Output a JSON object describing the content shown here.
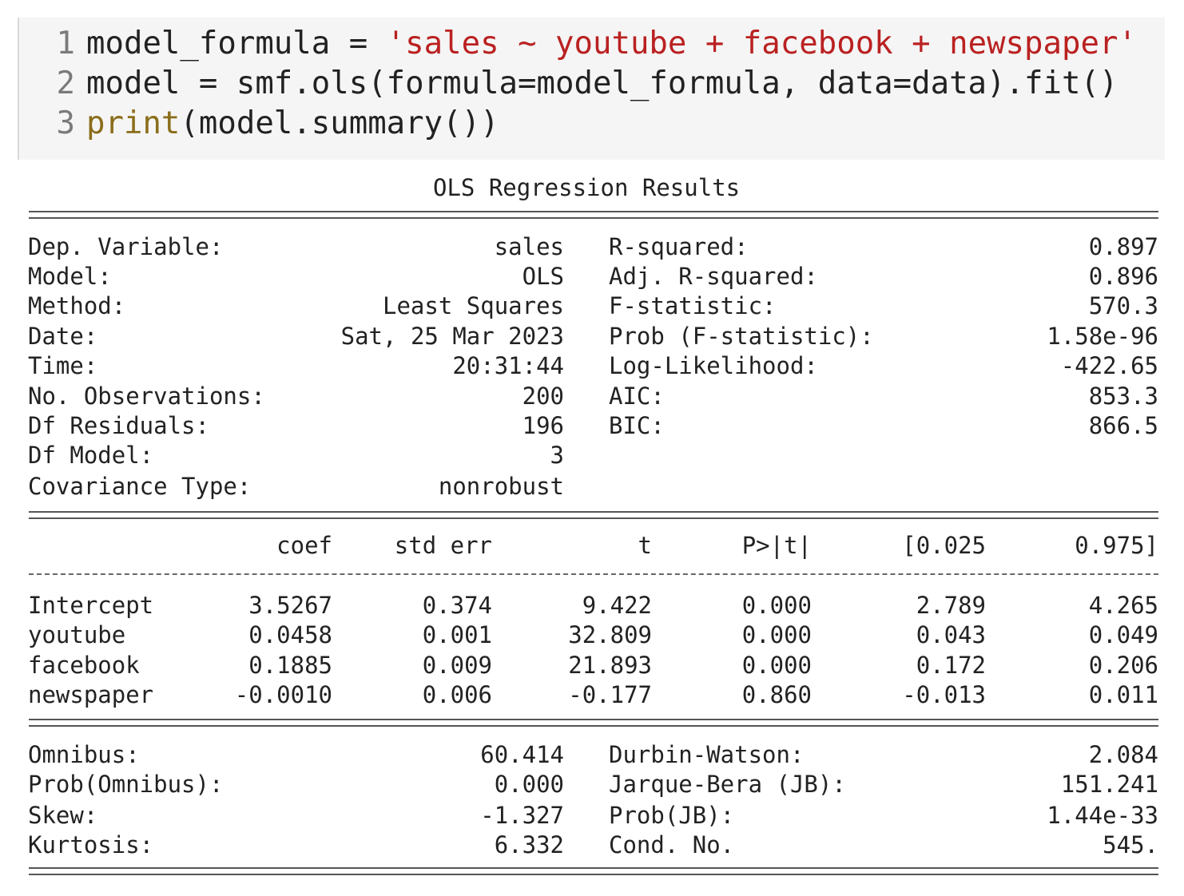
{
  "code": {
    "line_numbers": [
      "1",
      "2",
      "3"
    ],
    "line1": {
      "var": "model_formula",
      "op": " = ",
      "string": "'sales ~ youtube + facebook + newspaper'"
    },
    "line2": {
      "text": "model = smf.ols(formula=model_formula, data=data).fit()"
    },
    "line3": {
      "builtin": "print",
      "rest": "(model.summary())"
    }
  },
  "output": {
    "title": "OLS Regression Results",
    "rule_eq": "==============================================================================",
    "rule_dash": "------------------------------------------------------------------------------",
    "top_left": [
      {
        "label": "Dep. Variable:",
        "value": "sales"
      },
      {
        "label": "Model:",
        "value": "OLS"
      },
      {
        "label": "Method:",
        "value": "Least Squares"
      },
      {
        "label": "Date:",
        "value": "Sat, 25 Mar 2023"
      },
      {
        "label": "Time:",
        "value": "20:31:44"
      },
      {
        "label": "No. Observations:",
        "value": "200"
      },
      {
        "label": "Df Residuals:",
        "value": "196"
      },
      {
        "label": "Df Model:",
        "value": "3"
      },
      {
        "label": "Covariance Type:",
        "value": "nonrobust"
      }
    ],
    "top_right": [
      {
        "label": "R-squared:",
        "value": "0.897"
      },
      {
        "label": "Adj. R-squared:",
        "value": "0.896"
      },
      {
        "label": "F-statistic:",
        "value": "570.3"
      },
      {
        "label": "Prob (F-statistic):",
        "value": "1.58e-96"
      },
      {
        "label": "Log-Likelihood:",
        "value": "-422.65"
      },
      {
        "label": "AIC:",
        "value": "853.3"
      },
      {
        "label": "BIC:",
        "value": "866.5"
      }
    ],
    "coef_headers": [
      "coef",
      "std err",
      "t",
      "P>|t|",
      "[0.025",
      "0.975]"
    ],
    "coef_rows": [
      {
        "name": "Intercept",
        "values": [
          "3.5267",
          "0.374",
          "9.422",
          "0.000",
          "2.789",
          "4.265"
        ]
      },
      {
        "name": "youtube",
        "values": [
          "0.0458",
          "0.001",
          "32.809",
          "0.000",
          "0.043",
          "0.049"
        ]
      },
      {
        "name": "facebook",
        "values": [
          "0.1885",
          "0.009",
          "21.893",
          "0.000",
          "0.172",
          "0.206"
        ]
      },
      {
        "name": "newspaper",
        "values": [
          "-0.0010",
          "0.006",
          "-0.177",
          "0.860",
          "-0.013",
          "0.011"
        ]
      }
    ],
    "bottom_left": [
      {
        "label": "Omnibus:",
        "value": "60.414"
      },
      {
        "label": "Prob(Omnibus):",
        "value": "0.000"
      },
      {
        "label": "Skew:",
        "value": "-1.327"
      },
      {
        "label": "Kurtosis:",
        "value": "6.332"
      }
    ],
    "bottom_right": [
      {
        "label": "Durbin-Watson:",
        "value": "2.084"
      },
      {
        "label": "Jarque-Bera (JB):",
        "value": "151.241"
      },
      {
        "label": "Prob(JB):",
        "value": "1.44e-33"
      },
      {
        "label": "Cond. No.",
        "value": "545."
      }
    ]
  }
}
